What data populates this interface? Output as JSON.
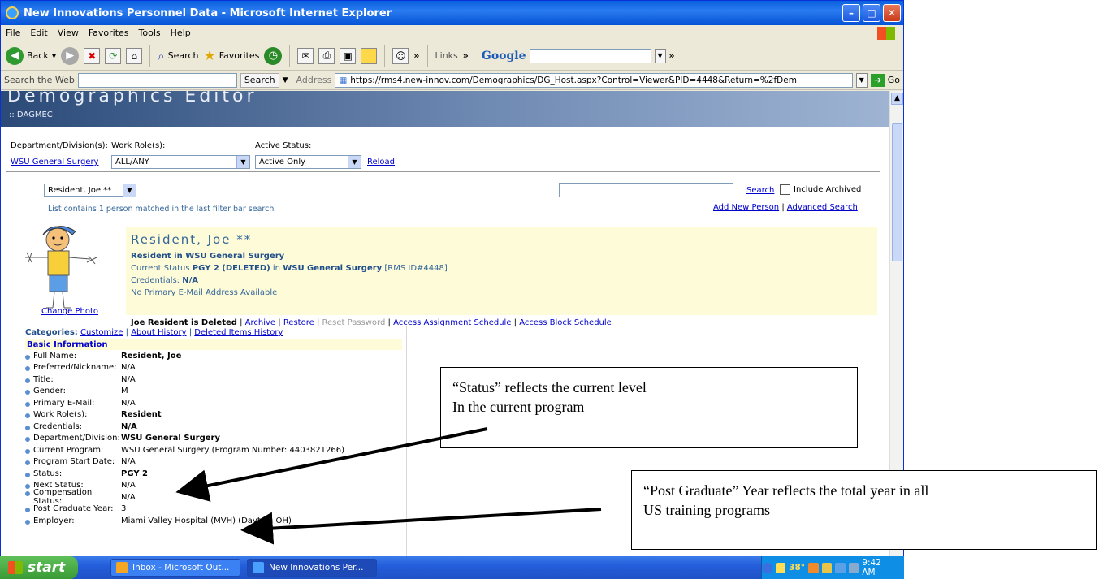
{
  "window": {
    "title": "New Innovations Personnel Data - Microsoft Internet Explorer"
  },
  "menu": [
    "File",
    "Edit",
    "View",
    "Favorites",
    "Tools",
    "Help"
  ],
  "toolbar": {
    "back": "Back",
    "search": "Search",
    "favorites": "Favorites",
    "links": "Links",
    "google": "Google"
  },
  "addressbar": {
    "search_web_label": "Search the Web",
    "search_btn": "Search",
    "address_label": "Address",
    "url": "https://rms4.new-innov.com/Demographics/DG_Host.aspx?Control=Viewer&PID=4448&Return=%2fDem",
    "go": "Go"
  },
  "banner": {
    "title": "Demographics Editor",
    "sub": ":: DAGMEC"
  },
  "filter": {
    "dept_label": "Department/Division(s):",
    "work_label": "Work Role(s):",
    "status_label": "Active Status:",
    "dept_value": "WSU General Surgery",
    "work_value": "ALL/ANY",
    "status_value": "Active Only",
    "reload": "Reload"
  },
  "person_bar": {
    "selected": "Resident, Joe **",
    "list_note": "List contains 1 person matched in the last filter bar search",
    "search_btn": "Search",
    "include_archived": "Include Archived",
    "add_new": "Add New Person",
    "advanced": "Advanced Search"
  },
  "person": {
    "name": "Resident, Joe **",
    "role_line": "Resident in WSU General Surgery",
    "status_pre": "Current Status",
    "status_val": "PGY 2 (DELETED)",
    "status_in": "in",
    "status_prog": "WSU General Surgery",
    "rms_id": "[RMS ID#4448]",
    "cred_pre": "Credentials:",
    "cred_val": "N/A",
    "email_note": "No Primary E-Mail Address Available",
    "change_photo": "Change Photo",
    "deleted_note": "Joe Resident is Deleted",
    "archive": "Archive",
    "restore": "Restore",
    "reset_password": "Reset Password",
    "access_assignment": "Access Assignment Schedule",
    "access_block": "Access Block Schedule"
  },
  "categories": {
    "label": "Categories:",
    "customize": "Customize",
    "about_history": "About History",
    "deleted_history": "Deleted Items History",
    "basic_info": "Basic Information",
    "rows": [
      {
        "k": "Full Name:",
        "v": "Resident, Joe",
        "bold": true
      },
      {
        "k": "Preferred/Nickname:",
        "v": "N/A",
        "bold": false
      },
      {
        "k": "Title:",
        "v": "N/A",
        "bold": false
      },
      {
        "k": "Gender:",
        "v": "M",
        "bold": false
      },
      {
        "k": "Primary E-Mail:",
        "v": "N/A",
        "bold": false
      },
      {
        "k": "Work Role(s):",
        "v": "Resident",
        "bold": true
      },
      {
        "k": "Credentials:",
        "v": "N/A",
        "bold": true
      },
      {
        "k": "Department/Division:",
        "v": "WSU General Surgery",
        "bold": true
      },
      {
        "k": "Current Program:",
        "v": "WSU General Surgery (Program Number: 4403821266)",
        "bold": false
      },
      {
        "k": "Program Start Date:",
        "v": "N/A",
        "bold": false
      },
      {
        "k": "Status:",
        "v": "PGY 2",
        "bold": true
      },
      {
        "k": "Next Status:",
        "v": "N/A",
        "bold": false
      },
      {
        "k": "Compensation Status:",
        "v": "N/A",
        "bold": false
      },
      {
        "k": "Post Graduate Year:",
        "v": "3",
        "bold": false
      },
      {
        "k": "Employer:",
        "v": "Miami Valley Hospital (MVH) (Dayton, OH)",
        "bold": false
      }
    ]
  },
  "notes": {
    "status_line1": "“Status” reflects the current level",
    "status_line2": "In the current program",
    "pgy_line1": "“Post Graduate” Year reflects the total year in all",
    "pgy_line2": "US training programs"
  },
  "taskbar": {
    "start": "start",
    "task1": "Inbox - Microsoft Out...",
    "task2": "New Innovations Per...",
    "temp": "38°",
    "time": "9:42 AM"
  }
}
